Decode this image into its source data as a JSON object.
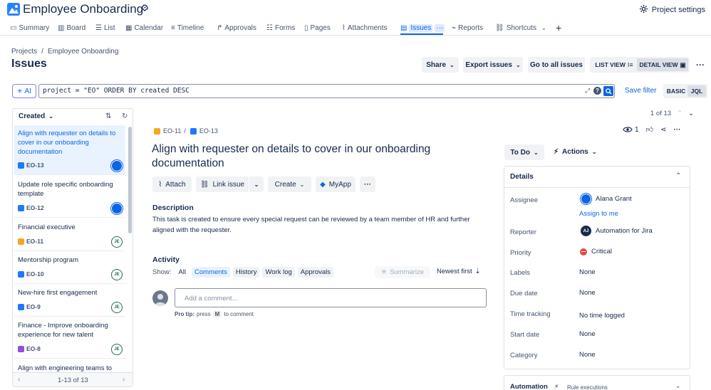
{
  "app": {
    "title": "Employee Onboarding",
    "settings_label": "Project settings"
  },
  "nav": {
    "tabs": [
      {
        "label": "Summary"
      },
      {
        "label": "Board"
      },
      {
        "label": "List"
      },
      {
        "label": "Calendar"
      },
      {
        "label": "Timeline"
      },
      {
        "label": "Approvals"
      },
      {
        "label": "Forms"
      },
      {
        "label": "Pages"
      },
      {
        "label": "Attachments"
      },
      {
        "label": "Issues"
      },
      {
        "label": "Reports"
      },
      {
        "label": "Shortcuts"
      }
    ],
    "active_tab": "Issues",
    "more_glyph": "···",
    "add_glyph": "+"
  },
  "breadcrumb": {
    "root": "Projects",
    "separator": "/",
    "project": "Employee Onboarding"
  },
  "page": {
    "title": "Issues"
  },
  "toolbar": {
    "share": "Share",
    "export": "Export issues",
    "go_all": "Go to all issues",
    "list_view": "LIST VIEW",
    "detail_view": "DETAIL VIEW",
    "more": "···"
  },
  "jql": {
    "ai_label": "AI",
    "query": "project = \"EO\" ORDER BY created DESC",
    "save_filter": "Save filter",
    "basic": "BASIC",
    "jql": "JQL"
  },
  "list": {
    "sort_label": "Created",
    "footer": "1-13 of 13",
    "items": [
      {
        "title": "Align with requester on details to cover in our onboarding documentation",
        "key": "EO-13",
        "type": "task"
      },
      {
        "title": "Update role specific onboarding template",
        "key": "EO-12",
        "type": "task"
      },
      {
        "title": "Financial executive",
        "key": "EO-11",
        "type": "epic"
      },
      {
        "title": "Mentorship program",
        "key": "EO-10",
        "type": "check"
      },
      {
        "title": "New-hire first engagement",
        "key": "EO-9",
        "type": "check"
      },
      {
        "title": "Finance - Improve onboarding experience for new talent",
        "key": "EO-8",
        "type": "subtask"
      },
      {
        "title": "Align with engineering teams to",
        "key": "",
        "type": "task"
      }
    ],
    "avatar_initials": "JE"
  },
  "issue": {
    "counter": "1 of 13",
    "parent_key": "EO-11",
    "key": "EO-13",
    "breadcrumb_sep": "/",
    "title": "Align with requester on details to cover in our onboarding documentation",
    "watch_count": "1",
    "actions": {
      "attach": "Attach",
      "link": "Link issue",
      "create": "Create",
      "myapp": "MyApp",
      "more": "···"
    },
    "description_heading": "Description",
    "description": "This task is created to ensure every special request can be reviewed by a team member of HR and further aligned with the requester.",
    "activity_heading": "Activity",
    "show_label": "Show:",
    "filters": [
      "All",
      "Comments",
      "History",
      "Work log",
      "Approvals"
    ],
    "active_filter": "Comments",
    "summarize": "Summarize",
    "sort": "Newest first",
    "comment_placeholder": "Add a comment...",
    "pro_tip_prefix": "Pro tip:",
    "pro_tip_press": "press",
    "pro_tip_key": "M",
    "pro_tip_suffix": "to comment"
  },
  "sidebar": {
    "status": "To Do",
    "actions": "Actions",
    "details_heading": "Details",
    "fields": {
      "assignee_label": "Assignee",
      "assignee": "Alana Grant",
      "assign_me": "Assign to me",
      "reporter_label": "Reporter",
      "reporter": "Automation for Jira",
      "reporter_initials": "AJ",
      "priority_label": "Priority",
      "priority": "Critical",
      "labels_label": "Labels",
      "labels": "None",
      "due_label": "Due date",
      "due": "None",
      "time_label": "Time tracking",
      "time": "No time logged",
      "start_label": "Start date",
      "start": "None",
      "category_label": "Category",
      "category": "None"
    },
    "automation_heading": "Automation",
    "rule_executions": "Rule executions"
  },
  "colors": {
    "accent": "#0c66e4",
    "critical": "#e2483d",
    "epic": "#f5a623",
    "story_blue": "#1d7afc",
    "subtask": "#8f4fe0",
    "je_green": "#216e4e"
  }
}
